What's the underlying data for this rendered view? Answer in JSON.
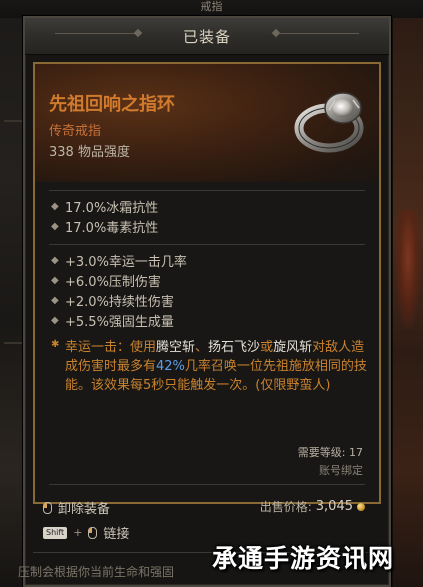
{
  "top_strip": {
    "text": "戒指"
  },
  "panel": {
    "header_title": "已装备",
    "item": {
      "name": "先祖回响之指环",
      "type": "传奇戒指",
      "power": "338 物品强度",
      "implicit_stats": [
        "17.0%冰霜抗性",
        "17.0%毒素抗性"
      ],
      "affixes": [
        "+3.0%幸运一击几率",
        "+6.0%压制伤害",
        "+2.0%持续性伤害",
        "+5.5%强固生成量"
      ],
      "unique_effect": {
        "p1": "幸运一击：使用",
        "h1": "腾空斩",
        "p2": "、",
        "h2": "扬石飞沙",
        "p3": "或",
        "h3": "旋风斩",
        "p4": "对敌人造成伤害时最多有",
        "h4": "42%",
        "p5": "几率召唤一位先祖施放相同的技能。该效果每5秒只能触发一次。(仅限野蛮人)"
      },
      "required_level": "需要等级: 17",
      "account_bound": "账号绑定",
      "sell_label": "出售价格:",
      "sell_value": "3,045"
    },
    "actions": {
      "unequip": "卸除装备",
      "link": "链接",
      "key_label": "Shift"
    },
    "bottom_text": "压制会根据你当前生命和强固"
  },
  "watermark": "承通手游资讯网",
  "colors": {
    "legendary": "#d07a2d",
    "unique_text": "#c9822e",
    "highlight_blue": "#5f9de8",
    "border_gold": "#8a6a34"
  },
  "icons": {
    "ring": "ancestral-ring-icon",
    "gold": "gold-coin-icon",
    "mouse": "mouse-icon",
    "key": "shift-key-icon"
  }
}
